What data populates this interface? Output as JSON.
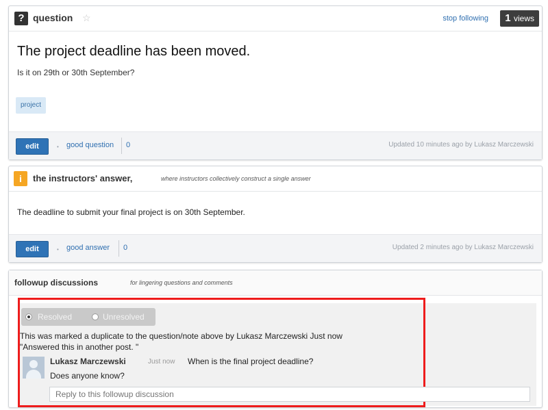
{
  "question": {
    "type_label": "question",
    "stop_following": "stop following",
    "views_count": "1",
    "views_label": "views",
    "title": "The project deadline has been moved.",
    "body": "Is it on 29th or 30th September?",
    "tag": "project",
    "edit_label": "edit",
    "vote_label": "good question",
    "vote_count": "0",
    "updated": "Updated 10 minutes ago by Lukasz Marczewski"
  },
  "answer": {
    "title": "the instructors' answer,",
    "subtitle": "where instructors collectively construct a single answer",
    "body": "The deadline to submit your final project is on 30th September.",
    "edit_label": "edit",
    "vote_label": "good answer",
    "vote_count": "0",
    "updated": "Updated 2 minutes ago by Lukasz Marczewski"
  },
  "followup": {
    "title": "followup discussions",
    "subtitle": "for lingering questions and comments",
    "resolved_label": "Resolved",
    "unresolved_label": "Unresolved",
    "duplicate_note": "This was marked a duplicate to the question/note above by Lukasz Marczewski Just now",
    "duplicate_quote": "\"Answered this in another post. \"",
    "author": "Lukasz Marczewski",
    "time": "Just now",
    "message": "When is the final project deadline?",
    "message2": "Does anyone know?",
    "reply_placeholder": "Reply to this followup discussion"
  },
  "colors": {
    "highlight": "#ee1c1c",
    "link": "#2f6fb0",
    "edit_button": "#2f73b6",
    "answer_icon": "#f5a623"
  }
}
